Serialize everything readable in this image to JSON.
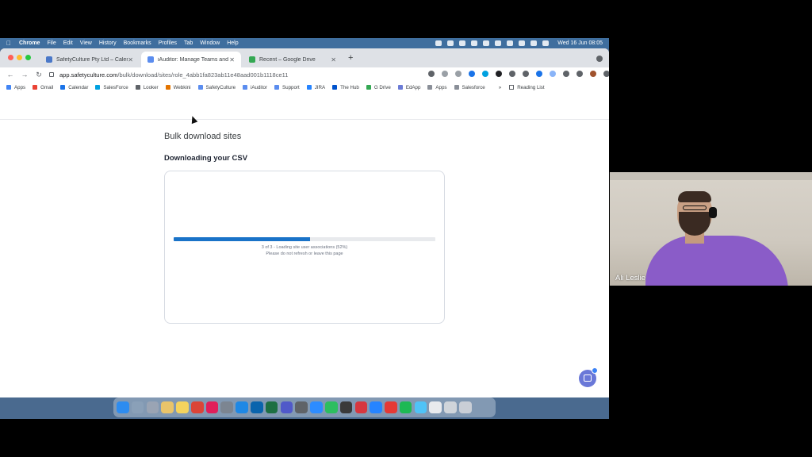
{
  "menubar": {
    "apple": "",
    "app_name": "Chrome",
    "items": [
      "File",
      "Edit",
      "View",
      "History",
      "Bookmarks",
      "Profiles",
      "Tab",
      "Window",
      "Help"
    ],
    "clock": "Wed 16 Jun  08:05"
  },
  "tabs": [
    {
      "label": "SafetyCulture Pty Ltd – Calend",
      "active": false,
      "favicon_color": "#4a78c8"
    },
    {
      "label": "iAuditor: Manage Teams and W",
      "active": true,
      "favicon_color": "#5b8def"
    },
    {
      "label": "Recent – Google Drive",
      "active": false,
      "favicon_color": "#34a853"
    }
  ],
  "tab_close_glyph": "✕",
  "new_tab_glyph": "+",
  "address_bar": {
    "host": "app.safetyculture.com",
    "path": "/bulk/download/sites/role_4abb1fa823ab11e48aad001b1118ce11"
  },
  "nav": {
    "back": "←",
    "forward": "→",
    "reload": "↻"
  },
  "bookmarks": [
    {
      "label": "Apps",
      "icon": "apps-grid-icon",
      "color": "#4285f4"
    },
    {
      "label": "Gmail",
      "icon": "gmail-icon",
      "color": "#ea4335"
    },
    {
      "label": "Calendar",
      "icon": "calendar-icon",
      "color": "#1a73e8"
    },
    {
      "label": "SalesForce",
      "icon": "salesforce-icon",
      "color": "#00a1e0"
    },
    {
      "label": "Looker",
      "icon": "looker-icon",
      "color": "#5f6368"
    },
    {
      "label": "Webkini",
      "icon": "webkini-icon",
      "color": "#e37400"
    },
    {
      "label": "SafetyCulture",
      "icon": "safetyculture-icon",
      "color": "#5b8def"
    },
    {
      "label": "iAuditor",
      "icon": "iauditor-icon",
      "color": "#5b8def"
    },
    {
      "label": "Support",
      "icon": "support-icon",
      "color": "#5b8def"
    },
    {
      "label": "JIRA",
      "icon": "jira-icon",
      "color": "#2684ff"
    },
    {
      "label": "The Hub",
      "icon": "hub-icon",
      "color": "#0052cc"
    },
    {
      "label": "G Drive",
      "icon": "drive-icon",
      "color": "#34a853"
    },
    {
      "label": "EdApp",
      "icon": "edapp-icon",
      "color": "#6b7bd6"
    },
    {
      "label": "Apps",
      "icon": "folder-icon",
      "color": "#8a8f98"
    },
    {
      "label": "Salesforce",
      "icon": "folder-icon",
      "color": "#8a8f98"
    }
  ],
  "bookmarks_more": "»",
  "reading_list": "Reading List",
  "page": {
    "title": "Bulk download sites",
    "section_title": "Downloading your CSV",
    "progress_fraction": 0.52,
    "progress_text": "3 of 3 - Loading site user associations (52%)",
    "progress_warning": "Please do not refresh or leave this page"
  },
  "colors": {
    "progress_fill": "#1a73c8",
    "chat_button": "#6a78d8"
  },
  "dock_icons": [
    {
      "name": "finder-icon",
      "color": "#2d8cf0"
    },
    {
      "name": "rocket-icon",
      "color": "#8aa0b8"
    },
    {
      "name": "launchpad-icon",
      "color": "#9aa4b4"
    },
    {
      "name": "photos-icon",
      "color": "#e9c46a"
    },
    {
      "name": "notes-icon",
      "color": "#f4d35e"
    },
    {
      "name": "chrome-icon",
      "color": "#db4437"
    },
    {
      "name": "slack-icon",
      "color": "#e01e5a"
    },
    {
      "name": "system-preferences-icon",
      "color": "#7c8591"
    },
    {
      "name": "app-store-icon",
      "color": "#1e88e5"
    },
    {
      "name": "outlook-icon",
      "color": "#0a64ad"
    },
    {
      "name": "excel-icon",
      "color": "#1d6f42"
    },
    {
      "name": "teams-icon",
      "color": "#5059c9"
    },
    {
      "name": "calculator-icon",
      "color": "#5f6368"
    },
    {
      "name": "zoom-icon",
      "color": "#2d8cff"
    },
    {
      "name": "evernote-icon",
      "color": "#2dbe60"
    },
    {
      "name": "quicktime-icon",
      "color": "#3a3a3a"
    },
    {
      "name": "acrobat-icon",
      "color": "#d7373f"
    },
    {
      "name": "jira-dock-icon",
      "color": "#2684ff"
    },
    {
      "name": "spotify-sync-icon",
      "color": "#e53935"
    },
    {
      "name": "spotify-icon",
      "color": "#1db954"
    },
    {
      "name": "sparkle-icon",
      "color": "#4fc3f7"
    },
    {
      "name": "document-icon",
      "color": "#e8eaed"
    },
    {
      "name": "window-icon",
      "color": "#cfd4da"
    },
    {
      "name": "trash-icon",
      "color": "#c9ced6"
    }
  ],
  "webcam": {
    "name": "Ali Leslie"
  }
}
